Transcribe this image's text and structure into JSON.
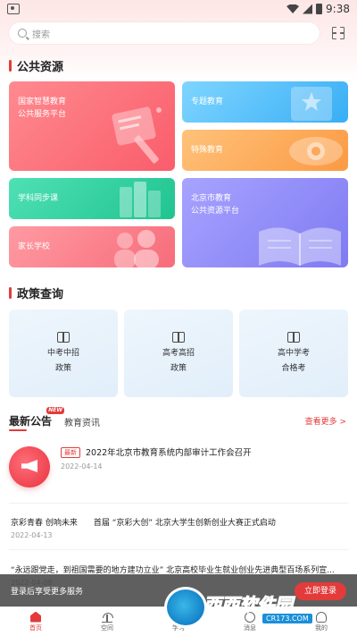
{
  "status_bar": {
    "time": "9:38"
  },
  "search": {
    "placeholder": "搜索"
  },
  "sections": {
    "public_resources": "公共资源",
    "policy_query": "政策查询"
  },
  "resource_cards": {
    "national": [
      "国家智慧教育",
      "公共服务平台"
    ],
    "special_topic": "专题教育",
    "special_education": "特殊教育",
    "sync_course": "学科同步课",
    "parent_school": "家长学校",
    "beijing": [
      "北京市教育",
      "公共资源平台"
    ]
  },
  "policy_cards": [
    {
      "line1": "中考中招",
      "line2": "政策"
    },
    {
      "line1": "高考高招",
      "line2": "政策"
    },
    {
      "line1": "高中学考",
      "line2": "合格考"
    }
  ],
  "news_tabs": {
    "latest": "最新公告",
    "new_badge": "NEW",
    "news": "教育资讯",
    "more": "查看更多 >"
  },
  "news": {
    "featured": {
      "tag": "最新",
      "title": "2022年北京市教育系统内部审计工作会召开",
      "date": "2022-04-14"
    },
    "items": [
      {
        "title": "京彩青春 创响未来　　首届 “京彩大创” 北京大学生创新创业大赛正式启动",
        "date": "2022-04-13"
      },
      {
        "title": "“永远跟党走，到祖国需要的地方建功立业” 北京高校毕业生就业创业先进典型百场系列宣...",
        "date": "2022-04-08"
      }
    ]
  },
  "login_banner": {
    "text": "登录后享受更多服务",
    "button": "立即登录"
  },
  "bottom_nav": [
    {
      "label": "首页",
      "icon": "home-icon",
      "active": true
    },
    {
      "label": "空间",
      "icon": "plant-icon",
      "active": false
    },
    {
      "label": "学习",
      "icon": "book-icon",
      "active": false
    },
    {
      "label": "消息",
      "icon": "message-icon",
      "active": false
    },
    {
      "label": "我的",
      "icon": "user-icon",
      "active": false
    }
  ],
  "watermark": {
    "brand": "西西软件园",
    "url": "CR173.COM"
  },
  "colors": {
    "accent": "#e33b3b",
    "national": "#f95d6b",
    "special_topic": "#38aef5",
    "special_education": "#fb9a43",
    "sync_course": "#20c48f",
    "parent_school": "#f76c7a",
    "beijing": "#7f7af2"
  }
}
